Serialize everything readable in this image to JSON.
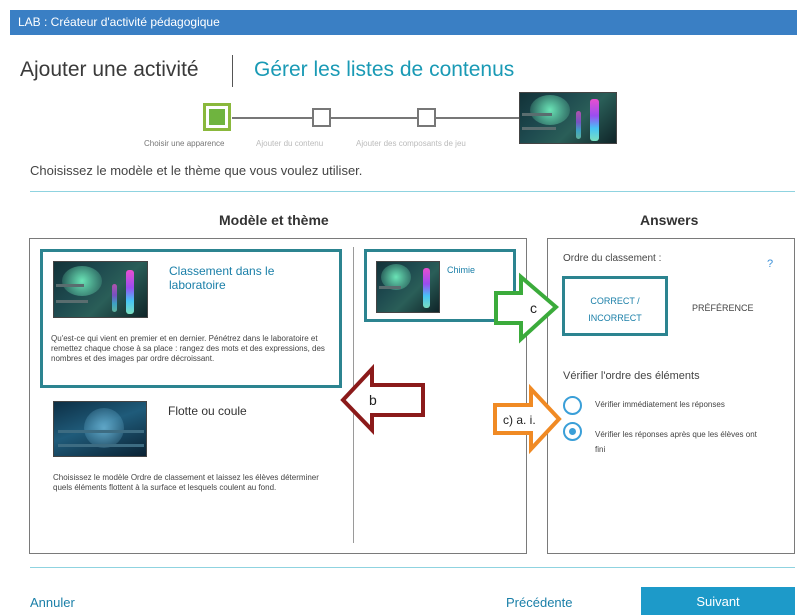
{
  "window": {
    "title": "LAB : Créateur d'activité pédagogique"
  },
  "tabs": {
    "add": "Ajouter une activité",
    "manage": "Gérer les listes de contenus"
  },
  "steps": [
    {
      "label": "Choisir une apparence",
      "active": true
    },
    {
      "label": "Ajouter du contenu",
      "active": false
    },
    {
      "label": "Ajouter des composants de jeu",
      "active": false
    }
  ],
  "instruction": "Choisissez le modèle et le thème que vous voulez utiliser.",
  "model_section": {
    "title": "Modèle et thème",
    "templates": [
      {
        "title": "Classement dans le laboratoire",
        "description": "Qu'est-ce qui vient en premier et en dernier. Pénétrez dans le laboratoire et remettez chaque chose à sa place : rangez des mots et des expressions, des nombres et des images par ordre décroissant.",
        "selected": true
      },
      {
        "title": "Flotte ou coule",
        "description": "Choisissez le modèle Ordre de classement et laissez les élèves déterminer quels éléments flottent à la surface et lesquels coulent au fond.",
        "selected": false
      }
    ],
    "theme": {
      "name": "Chimie",
      "selected": true
    }
  },
  "answers": {
    "title": "Answers",
    "order_label": "Ordre du classement :",
    "help": "?",
    "option_correct": "CORRECT / INCORRECT",
    "option_preference": "PRÉFÉRENCE",
    "verify_title": "Vérifier l'ordre des éléments",
    "verify_options": [
      {
        "label": "Vérifier immédiatement les réponses",
        "checked": false
      },
      {
        "label": "Vérifier les réponses après que les élèves ont fini",
        "checked": true
      }
    ]
  },
  "annotations": {
    "b": {
      "text": "b",
      "color": "#8b1a1a"
    },
    "c": {
      "text": "c",
      "color": "#3bab3b"
    },
    "cai": {
      "text": "c) a. i.",
      "color": "#f08a24"
    }
  },
  "footer": {
    "cancel": "Annuler",
    "previous": "Précédente",
    "next": "Suivant"
  },
  "colors": {
    "accent": "#1d9ac9",
    "title_bar": "#3a7fc4",
    "selected_border": "#2c8490",
    "step_active": "#6fb43f"
  }
}
